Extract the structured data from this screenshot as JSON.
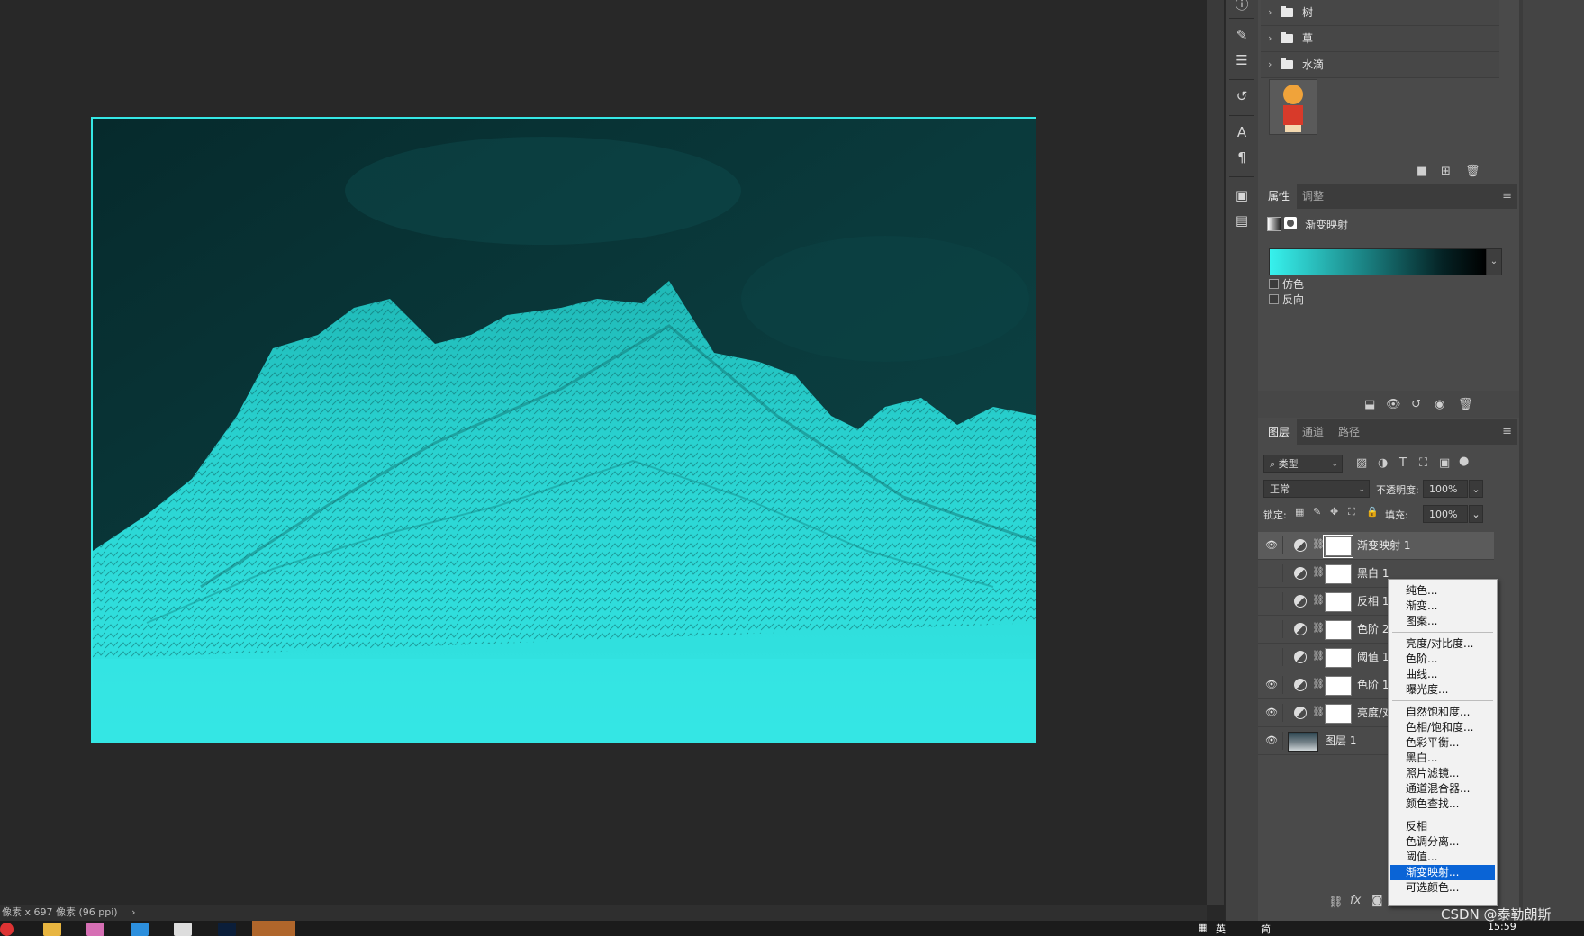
{
  "document": {
    "status_text": "像素 x 697 像素 (96 ppi)",
    "status_arrow": "›"
  },
  "layer_groups": [
    {
      "name": "树",
      "chevron": "›"
    },
    {
      "name": "草",
      "chevron": "›"
    },
    {
      "name": "水滴",
      "chevron": "›"
    }
  ],
  "properties_panel": {
    "tabs": [
      "属性",
      "调整"
    ],
    "active_tab": "属性",
    "adjustment_name": "渐变映射",
    "gradient_colors": [
      "#37f2ee",
      "#1a7f80",
      "#052224",
      "#000000"
    ],
    "options": [
      {
        "label": "仿色",
        "checked": false
      },
      {
        "label": "反向",
        "checked": false
      }
    ]
  },
  "layers_panel": {
    "tabs": [
      "图层",
      "通道",
      "路径"
    ],
    "active_tab": "图层",
    "filter_kind": "类型",
    "blend_mode": "正常",
    "opacity_label": "不透明度:",
    "opacity_value": "100%",
    "lock_label": "锁定:",
    "fill_label": "填充:",
    "fill_value": "100%",
    "layers": [
      {
        "name": "渐变映射 1",
        "visible": true,
        "selected": true,
        "type": "adjustment"
      },
      {
        "name": "黑白 1",
        "visible": false,
        "selected": false,
        "type": "adjustment"
      },
      {
        "name": "反相 1",
        "visible": false,
        "selected": false,
        "type": "adjustment"
      },
      {
        "name": "色阶 2",
        "visible": false,
        "selected": false,
        "type": "adjustment"
      },
      {
        "name": "阈值 1",
        "visible": false,
        "selected": false,
        "type": "adjustment"
      },
      {
        "name": "色阶 1",
        "visible": true,
        "selected": false,
        "type": "adjustment"
      },
      {
        "name": "亮度/对比度 1",
        "visible": true,
        "selected": false,
        "type": "adjustment"
      },
      {
        "name": "图层 1",
        "visible": true,
        "selected": false,
        "type": "pixel"
      }
    ]
  },
  "context_menu": {
    "groups": [
      [
        "纯色...",
        "渐变...",
        "图案..."
      ],
      [
        "亮度/对比度...",
        "色阶...",
        "曲线...",
        "曝光度..."
      ],
      [
        "自然饱和度...",
        "色相/饱和度...",
        "色彩平衡...",
        "黑白...",
        "照片滤镜...",
        "通道混合器...",
        "颜色查找..."
      ],
      [
        "反相",
        "色调分离...",
        "阈值...",
        "渐变映射...",
        "可选颜色..."
      ]
    ],
    "highlighted": "渐变映射..."
  },
  "taskbar": {
    "clock": "15:59",
    "tray_text": "英",
    "ime": "简"
  },
  "watermark": "CSDN @泰勒朗斯",
  "colors": {
    "cyan": "#35e8e6",
    "highlight": "#0a64d6",
    "panel": "#4a4a4a"
  }
}
